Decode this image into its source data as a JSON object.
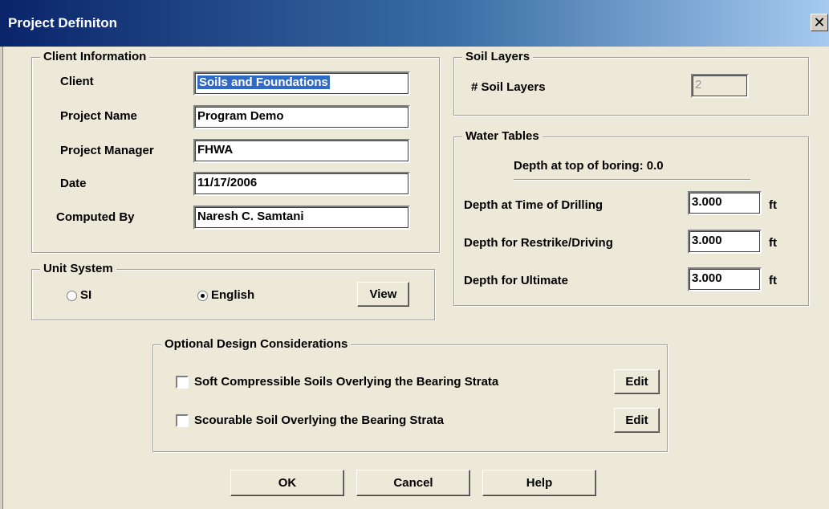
{
  "window": {
    "title": "Project Definiton",
    "close_glyph": "✕"
  },
  "client_info": {
    "legend": "Client Information",
    "fields": [
      {
        "label": "Client",
        "value": "Soils and Foundations"
      },
      {
        "label": "Project Name",
        "value": "Program Demo"
      },
      {
        "label": "Project Manager",
        "value": "FHWA"
      },
      {
        "label": "Date",
        "value": "11/17/2006"
      },
      {
        "label": "Computed By",
        "value": "Naresh C. Samtani"
      }
    ]
  },
  "unit_system": {
    "legend": "Unit System",
    "options": [
      {
        "label": "SI",
        "selected": false
      },
      {
        "label": "English",
        "selected": true
      }
    ],
    "view_button": "View"
  },
  "soil_layers": {
    "legend": "Soil Layers",
    "label": "# Soil Layers",
    "value": "2"
  },
  "water_tables": {
    "legend": "Water Tables",
    "top_of_boring": "Depth at top of boring: 0.0",
    "rows": [
      {
        "label": "Depth at Time of Drilling",
        "value": "3.000",
        "unit": "ft"
      },
      {
        "label": "Depth for Restrike/Driving",
        "value": "3.000",
        "unit": "ft"
      },
      {
        "label": "Depth for Ultimate",
        "value": "3.000",
        "unit": "ft"
      }
    ]
  },
  "optional_design": {
    "legend": "Optional Design Considerations",
    "items": [
      {
        "label": "Soft Compressible Soils Overlying the Bearing Strata",
        "checked": false,
        "edit": "Edit"
      },
      {
        "label": "Scourable Soil Overlying the Bearing Strata",
        "checked": false,
        "edit": "Edit"
      }
    ]
  },
  "buttons": {
    "ok": "OK",
    "cancel": "Cancel",
    "help": "Help"
  }
}
